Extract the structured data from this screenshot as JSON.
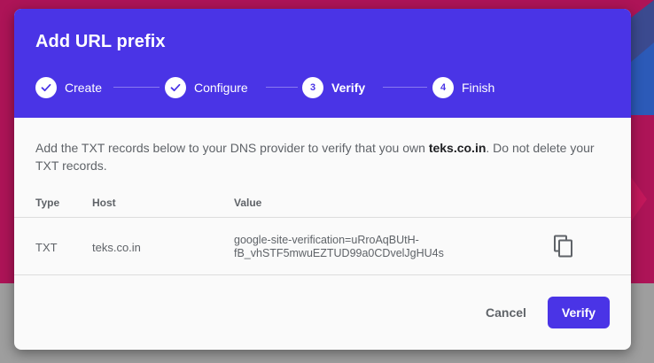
{
  "dialog": {
    "title": "Add URL prefix",
    "steps": [
      {
        "number": "1",
        "label": "Create",
        "state": "done"
      },
      {
        "number": "2",
        "label": "Configure",
        "state": "done"
      },
      {
        "number": "3",
        "label": "Verify",
        "state": "active"
      },
      {
        "number": "4",
        "label": "Finish",
        "state": "pending"
      }
    ],
    "description": {
      "before": "Add the TXT records below to your DNS provider to verify that you own ",
      "domain": "teks.co.in",
      "after": ". Do not delete your TXT records."
    },
    "table": {
      "headers": {
        "type": "Type",
        "host": "Host",
        "value": "Value"
      },
      "rows": [
        {
          "type": "TXT",
          "host": "teks.co.in",
          "value_line1": "google-site-verification=uRroAqBUtH-",
          "value_line2": "fB_vhSTF5mwuEZTUD99a0CDvelJgHU4s"
        }
      ]
    },
    "buttons": {
      "cancel": "Cancel",
      "verify": "Verify"
    }
  },
  "colors": {
    "header": "#4a34e6",
    "primary_button": "#4a34e6",
    "background_top": "#ad1457",
    "background_bottom": "#9e9e9e"
  },
  "icons": {
    "done": "check-icon",
    "copy": "copy-icon"
  }
}
